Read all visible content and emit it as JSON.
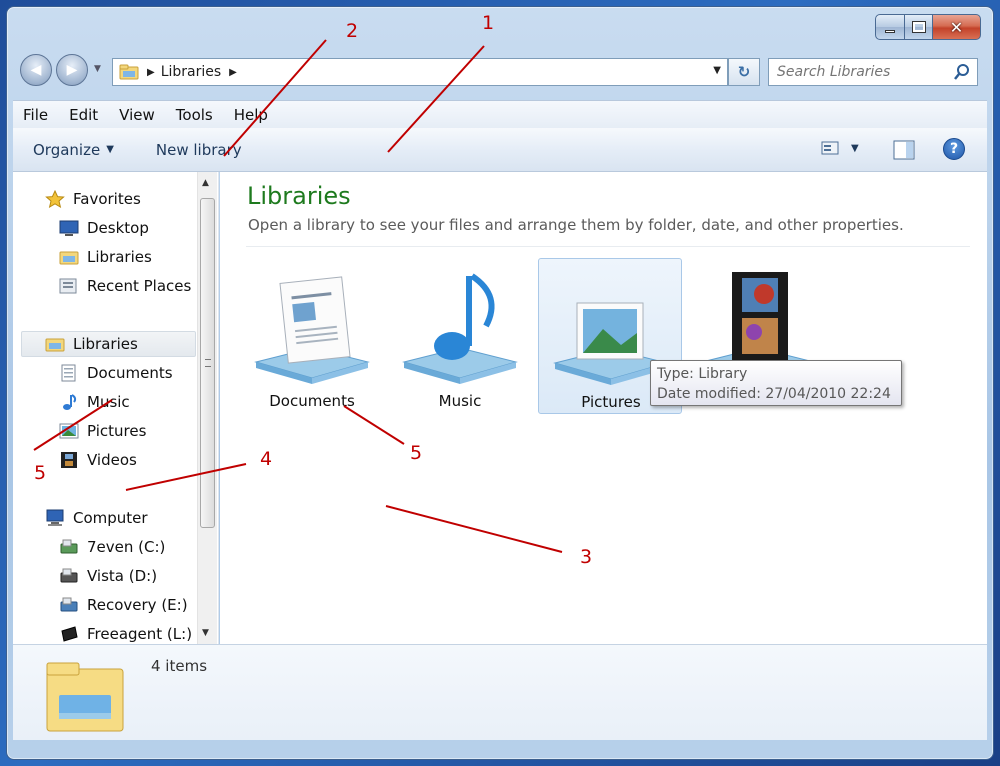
{
  "window": {
    "caption_buttons": [
      "minimize-icon",
      "maximize-icon",
      "close-icon"
    ]
  },
  "address": {
    "path": [
      "Libraries"
    ],
    "search_placeholder": "Search Libraries"
  },
  "menu": [
    "File",
    "Edit",
    "View",
    "Tools",
    "Help"
  ],
  "command_bar": {
    "organize_label": "Organize",
    "new_library_label": "New library"
  },
  "nav": {
    "favorites": {
      "label": "Favorites",
      "items": [
        "Desktop",
        "Libraries",
        "Recent Places"
      ]
    },
    "libraries": {
      "label": "Libraries",
      "items": [
        "Documents",
        "Music",
        "Pictures",
        "Videos"
      ]
    },
    "computer": {
      "label": "Computer",
      "items": [
        "7even (C:)",
        "Vista (D:)",
        "Recovery (E:)",
        "Freeagent (L:)"
      ]
    }
  },
  "content": {
    "title": "Libraries",
    "subtitle": "Open a library to see your files and arrange them by folder, date, and other properties.",
    "libraries": [
      "Documents",
      "Music",
      "Pictures",
      "Videos"
    ],
    "selected": "Pictures"
  },
  "tooltip": {
    "line1": "Type: Library",
    "line2": "Date modified: 27/04/2010 22:24"
  },
  "details": {
    "count": "4 items"
  },
  "annotations": {
    "labels": [
      "1",
      "2",
      "3",
      "4",
      "5",
      "5"
    ],
    "color": "#c00000"
  },
  "colors": {
    "title_green": "#1e7a1e",
    "accent_blue": "#1e395b",
    "window_frame": "#a9c6e6"
  }
}
